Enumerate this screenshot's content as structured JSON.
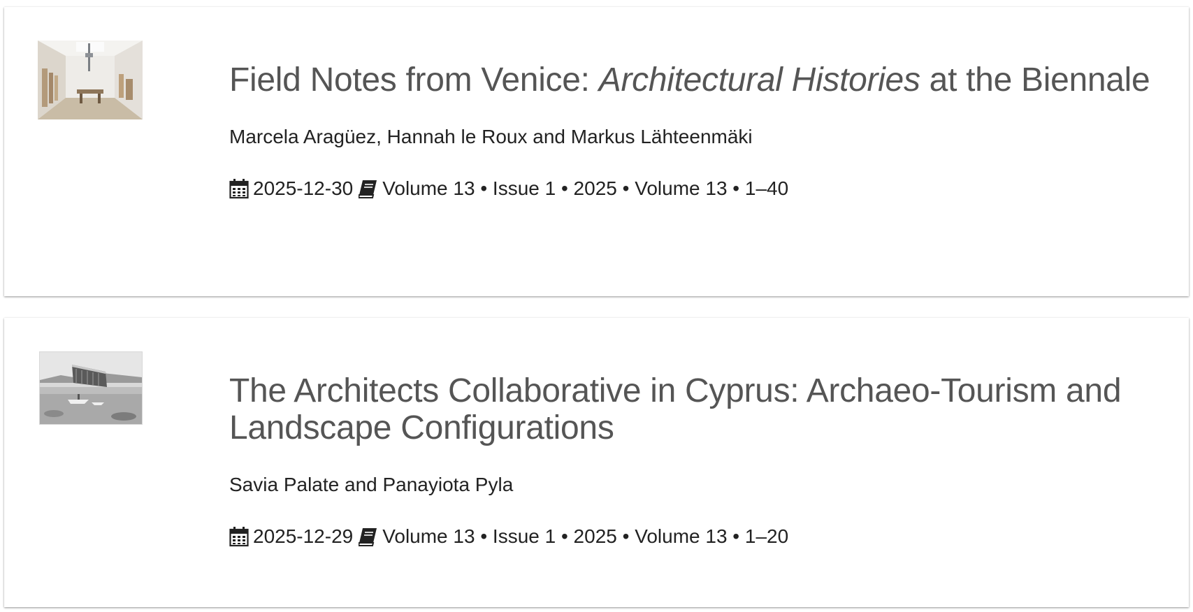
{
  "articles": [
    {
      "title_before": "Field Notes from Venice: ",
      "title_italic": "Architectural Histories",
      "title_after": " at the Biennale",
      "authors": "Marcela Aragüez, Hannah le Roux and Markus Lähteenmäki",
      "date": "2025-12-30",
      "volume_info": "Volume 13 • Issue 1 • 2025 • Volume 13 • 1–40",
      "thumbnail": "gallery-interior-photo"
    },
    {
      "title_before": "The Architects Collaborative in Cyprus: Archaeo-Tourism and Landscape Configurations",
      "title_italic": "",
      "title_after": "",
      "authors": "Savia Palate and Panayiota Pyla",
      "date": "2025-12-29",
      "volume_info": "Volume 13 • Issue 1 • 2025 • Volume 13 • 1–20",
      "thumbnail": "coastal-hotel-bw-photo"
    }
  ],
  "icons": {
    "date": "calendar-icon",
    "issue": "book-icon"
  },
  "colors": {
    "title": "#555555",
    "text": "#222222",
    "card": "#ffffff"
  }
}
